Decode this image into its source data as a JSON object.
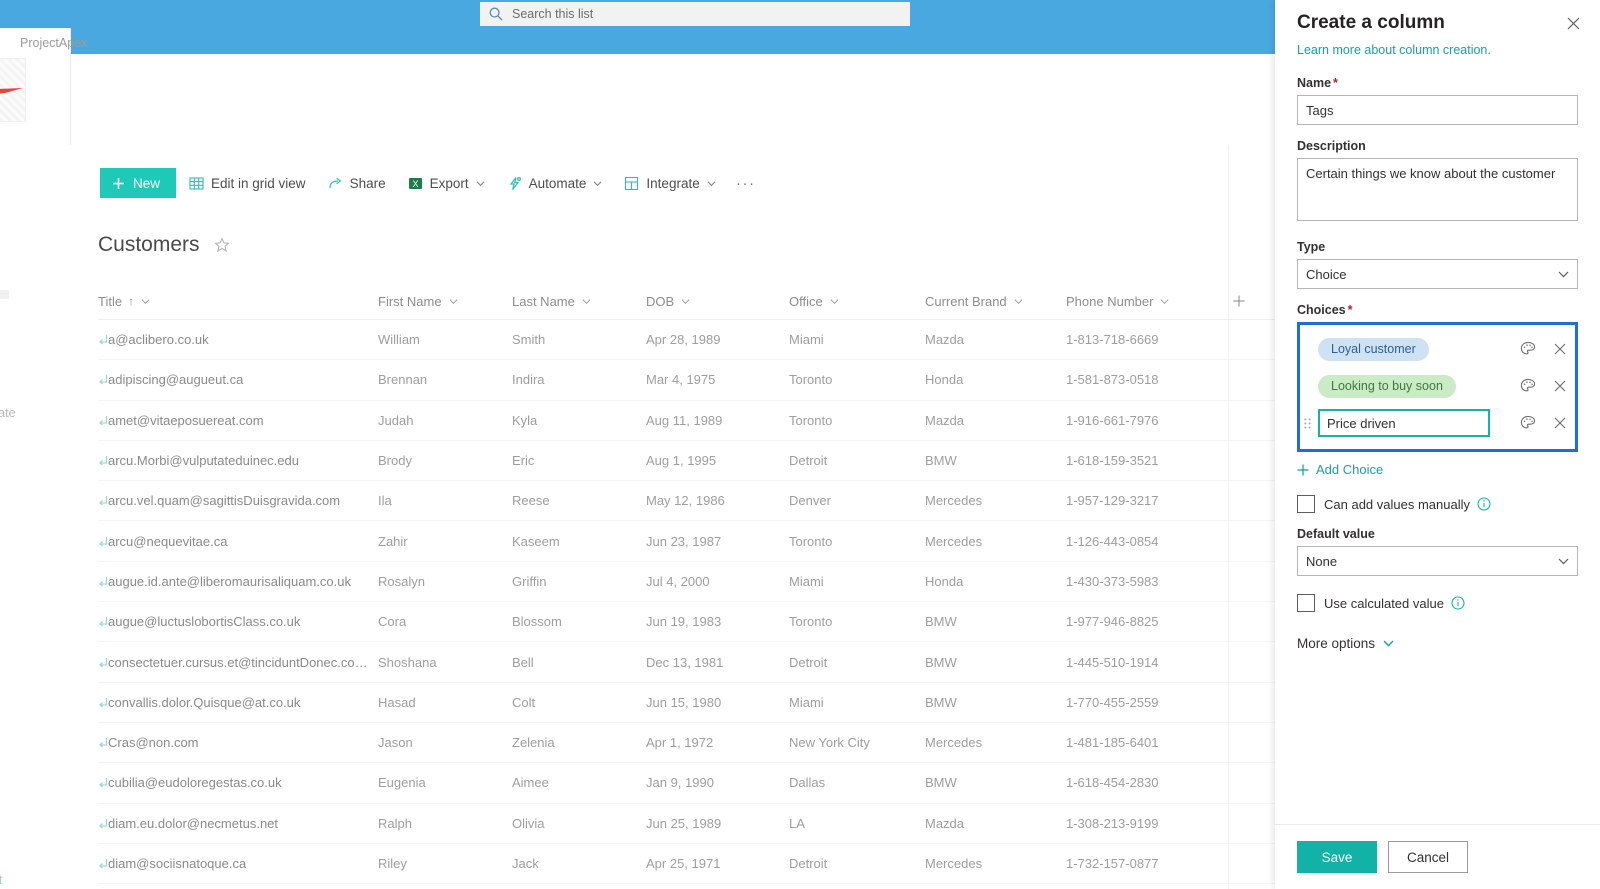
{
  "suite": {
    "search": {
      "placeholder": "Search this list",
      "icon": "search-icon"
    }
  },
  "site": {
    "name": "ProjectApex",
    "rail_template_label": "mplate",
    "rail_bottom_label": "nt"
  },
  "toolbar": {
    "new_label": "New",
    "items": [
      {
        "label": "Edit in grid view",
        "icon": "grid-icon",
        "has_chevron": false
      },
      {
        "label": "Share",
        "icon": "share-icon",
        "has_chevron": false
      },
      {
        "label": "Export",
        "icon": "excel-icon",
        "has_chevron": true
      },
      {
        "label": "Automate",
        "icon": "automate-icon",
        "has_chevron": true
      },
      {
        "label": "Integrate",
        "icon": "integrate-icon",
        "has_chevron": true
      }
    ],
    "overflow_label": "···"
  },
  "list": {
    "title": "Customers",
    "favorite_icon": "star-icon",
    "sort_indicator": "↑",
    "columns": [
      {
        "label": "Title",
        "key": "title",
        "sorted": true
      },
      {
        "label": "First Name",
        "key": "first"
      },
      {
        "label": "Last Name",
        "key": "last"
      },
      {
        "label": "DOB",
        "key": "dob"
      },
      {
        "label": "Office",
        "key": "office"
      },
      {
        "label": "Current Brand",
        "key": "brand"
      },
      {
        "label": "Phone Number",
        "key": "phone"
      }
    ],
    "add_column_icon": "plus-icon",
    "rows": [
      {
        "title": "a@aclibero.co.uk",
        "first": "William",
        "last": "Smith",
        "dob": "Apr 28, 1989",
        "office": "Miami",
        "brand": "Mazda",
        "phone": "1-813-718-6669"
      },
      {
        "title": "adipiscing@augueut.ca",
        "first": "Brennan",
        "last": "Indira",
        "dob": "Mar 4, 1975",
        "office": "Toronto",
        "brand": "Honda",
        "phone": "1-581-873-0518"
      },
      {
        "title": "amet@vitaeposuereat.com",
        "first": "Judah",
        "last": "Kyla",
        "dob": "Aug 11, 1989",
        "office": "Toronto",
        "brand": "Mazda",
        "phone": "1-916-661-7976"
      },
      {
        "title": "arcu.Morbi@vulputateduinec.edu",
        "first": "Brody",
        "last": "Eric",
        "dob": "Aug 1, 1995",
        "office": "Detroit",
        "brand": "BMW",
        "phone": "1-618-159-3521"
      },
      {
        "title": "arcu.vel.quam@sagittisDuisgravida.com",
        "first": "Ila",
        "last": "Reese",
        "dob": "May 12, 1986",
        "office": "Denver",
        "brand": "Mercedes",
        "phone": "1-957-129-3217"
      },
      {
        "title": "arcu@nequevitae.ca",
        "first": "Zahir",
        "last": "Kaseem",
        "dob": "Jun 23, 1987",
        "office": "Toronto",
        "brand": "Mercedes",
        "phone": "1-126-443-0854"
      },
      {
        "title": "augue.id.ante@liberomaurisaliquam.co.uk",
        "first": "Rosalyn",
        "last": "Griffin",
        "dob": "Jul 4, 2000",
        "office": "Miami",
        "brand": "Honda",
        "phone": "1-430-373-5983"
      },
      {
        "title": "augue@luctuslobortisClass.co.uk",
        "first": "Cora",
        "last": "Blossom",
        "dob": "Jun 19, 1983",
        "office": "Toronto",
        "brand": "BMW",
        "phone": "1-977-946-8825"
      },
      {
        "title": "consectetuer.cursus.et@tinciduntDonec.co.uk",
        "first": "Shoshana",
        "last": "Bell",
        "dob": "Dec 13, 1981",
        "office": "Detroit",
        "brand": "BMW",
        "phone": "1-445-510-1914"
      },
      {
        "title": "convallis.dolor.Quisque@at.co.uk",
        "first": "Hasad",
        "last": "Colt",
        "dob": "Jun 15, 1980",
        "office": "Miami",
        "brand": "BMW",
        "phone": "1-770-455-2559"
      },
      {
        "title": "Cras@non.com",
        "first": "Jason",
        "last": "Zelenia",
        "dob": "Apr 1, 1972",
        "office": "New York City",
        "brand": "Mercedes",
        "phone": "1-481-185-6401"
      },
      {
        "title": "cubilia@eudoloregestas.co.uk",
        "first": "Eugenia",
        "last": "Aimee",
        "dob": "Jan 9, 1990",
        "office": "Dallas",
        "brand": "BMW",
        "phone": "1-618-454-2830"
      },
      {
        "title": "diam.eu.dolor@necmetus.net",
        "first": "Ralph",
        "last": "Olivia",
        "dob": "Jun 25, 1989",
        "office": "LA",
        "brand": "Mazda",
        "phone": "1-308-213-9199"
      },
      {
        "title": "diam@sociisnatoque.ca",
        "first": "Riley",
        "last": "Jack",
        "dob": "Apr 25, 1971",
        "office": "Detroit",
        "brand": "Mercedes",
        "phone": "1-732-157-0877"
      }
    ]
  },
  "panel": {
    "title": "Create a column",
    "close_icon": "close-icon",
    "learn_more": "Learn more about column creation.",
    "name": {
      "label": "Name",
      "required": true,
      "value": "Tags"
    },
    "description": {
      "label": "Description",
      "value": "Certain things we know about the customer"
    },
    "type": {
      "label": "Type",
      "value": "Choice"
    },
    "choices": {
      "label": "Choices",
      "required": true,
      "items": [
        {
          "value": "Loyal customer",
          "color": "blue",
          "editing": false
        },
        {
          "value": "Looking to buy soon",
          "color": "green",
          "editing": false
        },
        {
          "value": "Price driven",
          "color": "none",
          "editing": true
        }
      ],
      "palette_icon": "palette-icon",
      "delete_icon": "close-icon",
      "drag_icon": "drag-handle-icon",
      "add_label": "Add Choice"
    },
    "can_add_manually": {
      "label": "Can add values manually",
      "checked": false
    },
    "default_value": {
      "label": "Default value",
      "value": "None"
    },
    "use_calculated": {
      "label": "Use calculated value",
      "checked": false
    },
    "more_options": "More options",
    "save_label": "Save",
    "cancel_label": "Cancel"
  },
  "colors": {
    "suite_bar": "#4aa8e0",
    "accent_teal": "#12b2a6",
    "new_button": "#1ec9b7",
    "focus_blue": "#1f6fd0",
    "pill_blue_bg": "#cfe2f3",
    "pill_blue_text": "#2a6099",
    "pill_green_bg": "#caebc5",
    "pill_green_text": "#3c7a3b"
  }
}
